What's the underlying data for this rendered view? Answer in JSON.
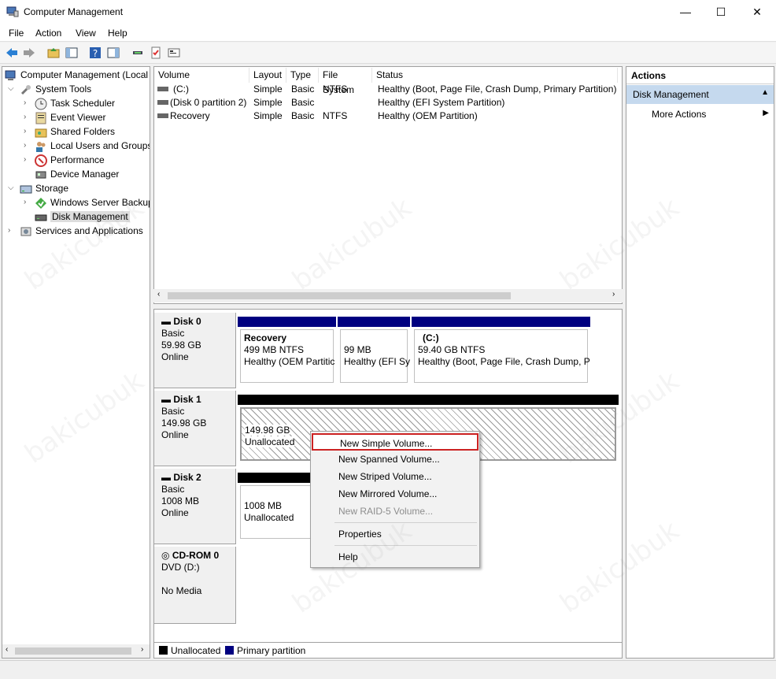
{
  "window": {
    "title": "Computer Management",
    "minimize": "—",
    "maximize": "☐",
    "close": "✕"
  },
  "menu": [
    "File",
    "Action",
    "View",
    "Help"
  ],
  "tree": {
    "root": "Computer Management (Local",
    "system_tools": "System Tools",
    "task_scheduler": "Task Scheduler",
    "event_viewer": "Event Viewer",
    "shared_folders": "Shared Folders",
    "local_users": "Local Users and Groups",
    "performance": "Performance",
    "device_manager": "Device Manager",
    "storage": "Storage",
    "wsb": "Windows Server Backup",
    "disk_mgmt": "Disk Management",
    "services": "Services and Applications"
  },
  "volumes": {
    "headers": [
      "Volume",
      "Layout",
      "Type",
      "File System",
      "Status"
    ],
    "rows": [
      [
        "(C:)",
        "Simple",
        "Basic",
        "NTFS",
        "Healthy (Boot, Page File, Crash Dump, Primary Partition)"
      ],
      [
        "(Disk 0 partition 2)",
        "Simple",
        "Basic",
        "",
        "Healthy (EFI System Partition)"
      ],
      [
        "Recovery",
        "Simple",
        "Basic",
        "NTFS",
        "Healthy (OEM Partition)"
      ]
    ]
  },
  "disks": {
    "disk0": {
      "name": "Disk 0",
      "type": "Basic",
      "size": "59.98 GB",
      "state": "Online"
    },
    "disk0_p1": {
      "name": "Recovery",
      "size": "499 MB NTFS",
      "status": "Healthy (OEM Partitic"
    },
    "disk0_p2": {
      "size": "99 MB",
      "status": "Healthy (EFI Sy"
    },
    "disk0_p3": {
      "name": "(C:)",
      "size": "59.40 GB NTFS",
      "status": "Healthy (Boot, Page File, Crash Dump, P"
    },
    "disk1": {
      "name": "Disk 1",
      "type": "Basic",
      "size": "149.98 GB",
      "state": "Online"
    },
    "disk1_p1": {
      "size": "149.98 GB",
      "status": "Unallocated"
    },
    "disk2": {
      "name": "Disk 2",
      "type": "Basic",
      "size": "1008 MB",
      "state": "Online"
    },
    "disk2_p1": {
      "size": "1008 MB",
      "status": "Unallocated"
    },
    "cdrom": {
      "name": "CD-ROM 0",
      "type": "DVD (D:)",
      "state": "No Media"
    }
  },
  "legend": {
    "unallocated": "Unallocated",
    "primary": "Primary partition"
  },
  "actions": {
    "header": "Actions",
    "section": "Disk Management",
    "more": "More Actions"
  },
  "context_menu": {
    "new_simple": "New Simple Volume...",
    "new_spanned": "New Spanned Volume...",
    "new_striped": "New Striped Volume...",
    "new_mirrored": "New Mirrored Volume...",
    "new_raid5": "New RAID-5 Volume...",
    "properties": "Properties",
    "help": "Help"
  },
  "colors": {
    "primary_partition": "#000080",
    "unallocated": "#000000",
    "highlight_border": "#cc2222",
    "actions_selected": "#c5d9ee"
  },
  "watermark": "bakicubuk"
}
